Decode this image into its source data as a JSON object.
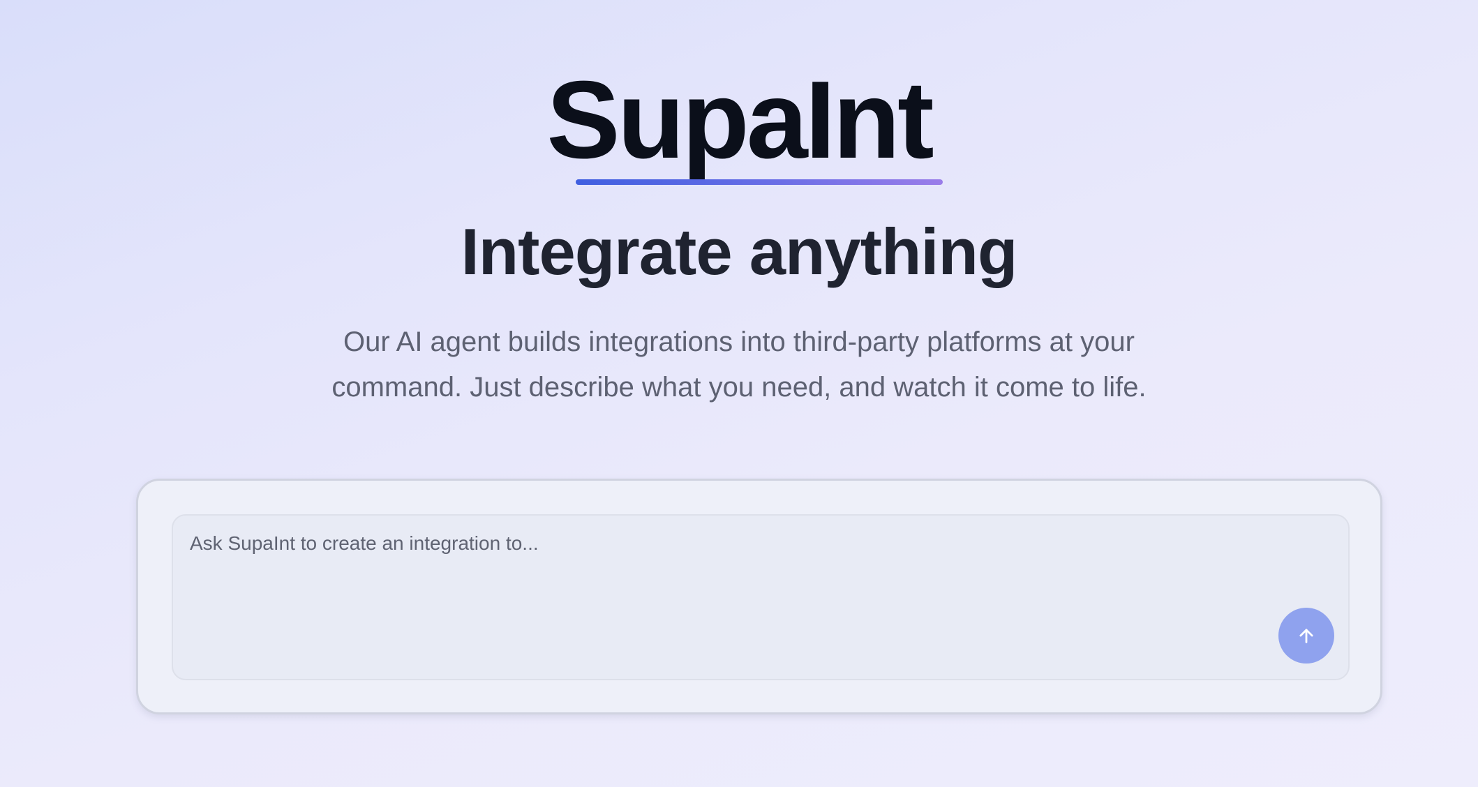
{
  "brand": {
    "name": "SupaInt"
  },
  "hero": {
    "headline": "Integrate anything",
    "description": "Our AI agent builds integrations into third-party platforms at your command. Just describe what you need, and watch it come to life."
  },
  "prompt": {
    "placeholder": "Ask SupaInt to create an integration to...",
    "value": "",
    "send_icon": "arrow-up-icon"
  },
  "colors": {
    "accent_gradient_start": "#3f5fe0",
    "accent_gradient_end": "#9a7de9",
    "send_button": "#8fa2ee",
    "title": "#0b0f1a",
    "headline": "#1f2330",
    "body_text": "#5d6172"
  }
}
